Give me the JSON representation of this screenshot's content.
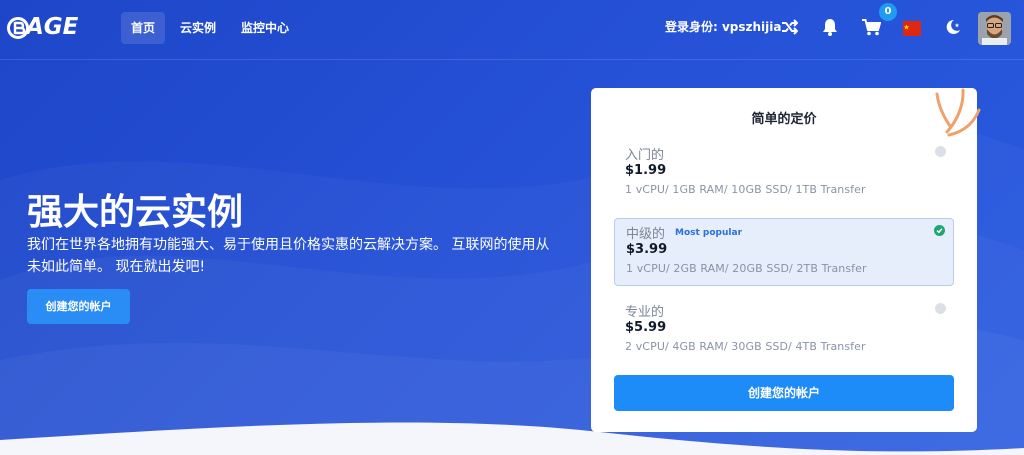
{
  "header": {
    "logo_text": "AGE",
    "nav": [
      {
        "label": "首页",
        "active": true
      },
      {
        "label": "云实例",
        "active": false
      },
      {
        "label": "监控中心",
        "active": false
      }
    ],
    "login_label": "登录身份: vpszhijia",
    "cart_count": "0",
    "icons": [
      "shuffle-icon",
      "bell-icon",
      "cart-icon",
      "china-flag-icon",
      "moon-star-icon",
      "avatar"
    ]
  },
  "hero": {
    "title": "强大的云实例",
    "description": "我们在世界各地拥有功能强大、易于使用且价格实惠的云解决方案。 互联网的使用从未如此简单。 现在就出发吧!",
    "button": "创建您的帐户"
  },
  "pricing": {
    "title": "简单的定价",
    "plans": [
      {
        "name": "入门的",
        "badge": "",
        "price": "$1.99",
        "spec": "1 vCPU/ 1GB RAM/ 10GB SSD/ 1TB Transfer",
        "selected": false
      },
      {
        "name": "中级的",
        "badge": "Most popular",
        "price": "$3.99",
        "spec": "1 vCPU/ 2GB RAM/ 20GB SSD/ 2TB Transfer",
        "selected": true
      },
      {
        "name": "专业的",
        "badge": "",
        "price": "$5.99",
        "spec": "2 vCPU/ 4GB RAM/ 30GB SSD/ 4TB Transfer",
        "selected": false
      }
    ],
    "button": "创建您的帐户"
  },
  "colors": {
    "background": "#2551d6",
    "accent": "#1e8cf8",
    "check": "#1ea672",
    "badge": "#2a6fe0"
  }
}
